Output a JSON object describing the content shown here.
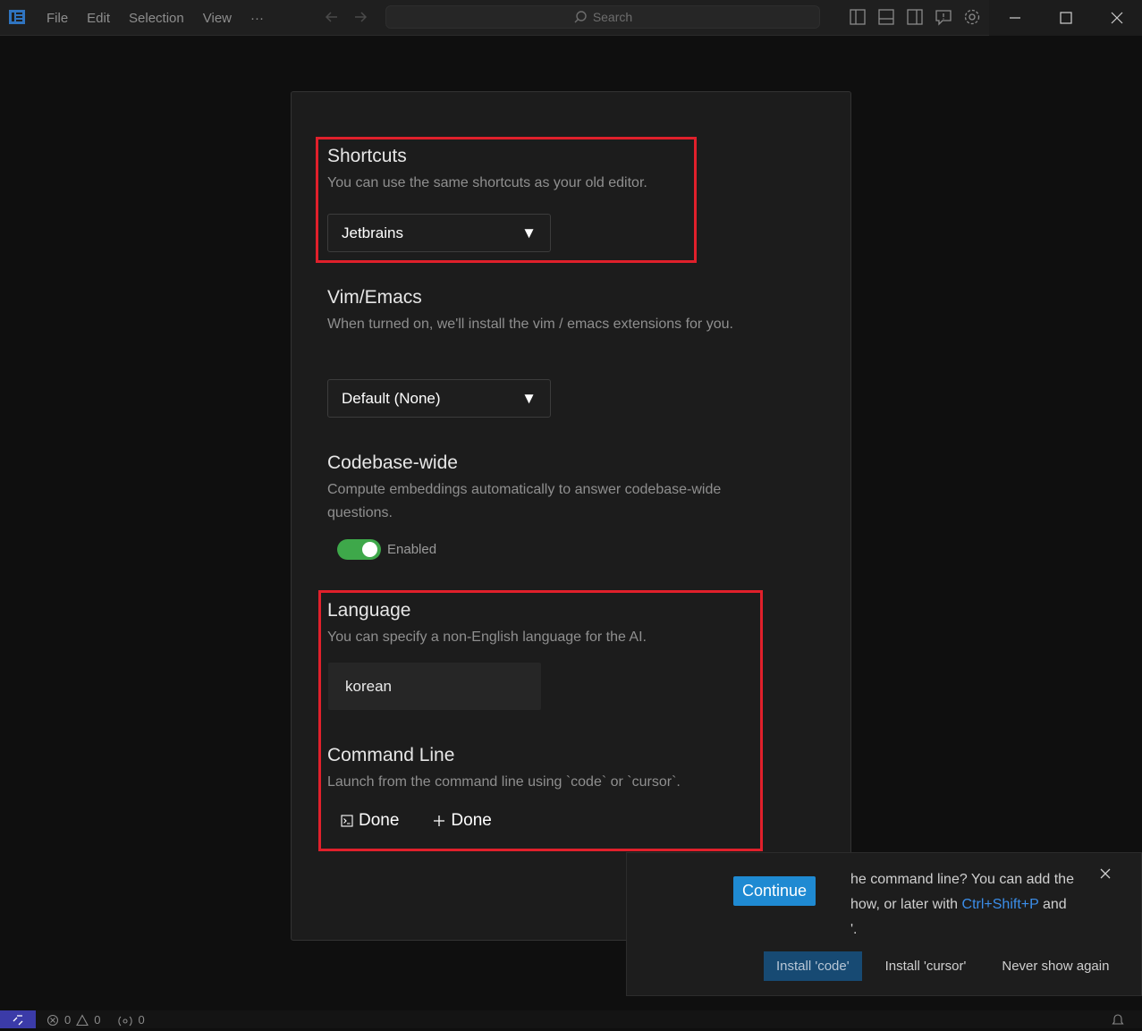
{
  "menu": {
    "file": "File",
    "edit": "Edit",
    "selection": "Selection",
    "view": "View",
    "more": "···"
  },
  "search": {
    "placeholder": "Search"
  },
  "shortcuts": {
    "title": "Shortcuts",
    "description": "You can use the same shortcuts as your old editor.",
    "selected": "Jetbrains"
  },
  "vim": {
    "title": "Vim/Emacs",
    "description": "When turned on, we'll install the vim / emacs extensions for you.",
    "selected": "Default (None)"
  },
  "codebase": {
    "title": "Codebase-wide",
    "description": "Compute embeddings automatically to answer codebase-wide questions.",
    "toggle_label": "Enabled",
    "toggle_on": true
  },
  "language": {
    "title": "Language",
    "description": "You can specify a non-English language for the AI.",
    "value": "korean"
  },
  "command_line": {
    "title": "Command Line",
    "description": "Launch from the command line using `code` or `cursor`.",
    "button1": "Done",
    "button2": "Done"
  },
  "continue_label": "Continue",
  "notification": {
    "text_part1": "he command line? You can add the",
    "text_part2": "how, or later with",
    "shortcut": "Ctrl+Shift+P",
    "text_part3": "and",
    "text_part4": "'.",
    "install_code": "Install 'code'",
    "install_cursor": "Install 'cursor'",
    "never_show": "Never show again"
  },
  "status": {
    "errors": "0",
    "warnings": "0",
    "ports": "0"
  },
  "colors": {
    "accent": "#1f8ad2",
    "toggle_on": "#3ea84a",
    "highlight": "#e0202b"
  }
}
